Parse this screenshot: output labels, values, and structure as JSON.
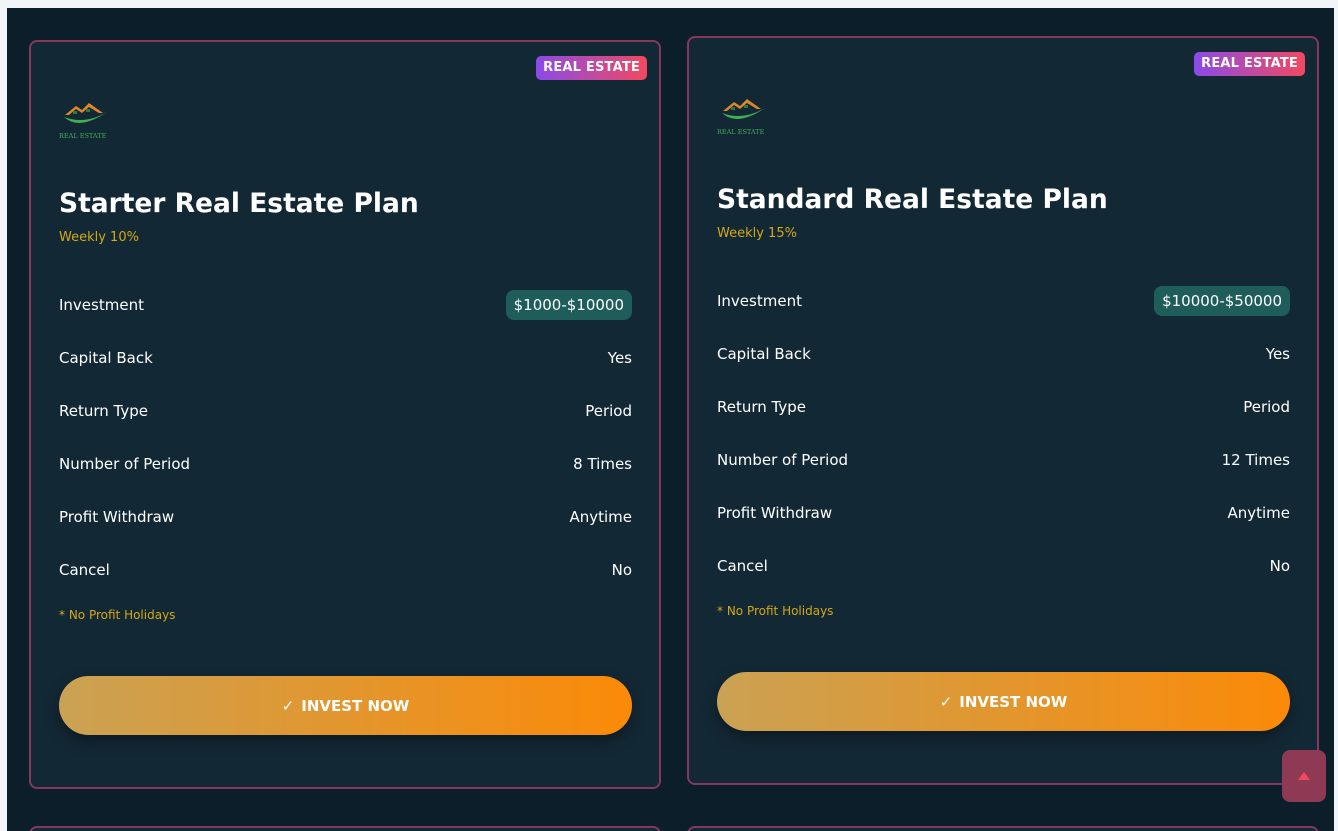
{
  "colors": {
    "page_bg": "#0b1e29",
    "card_bg": "#132835",
    "card_border": "#84385e",
    "accent_gold": "#d4a817",
    "pill_bg": "#1e5d5a",
    "button_gradient": [
      "#caa254",
      "#fb8a07"
    ],
    "badge_gradient": [
      "#8b4ae8",
      "#f2495f"
    ]
  },
  "plans": [
    {
      "badge": "REAL ESTATE",
      "logo_text": "REAL ESTATE",
      "title": "Starter Real Estate Plan",
      "rate": "Weekly 10%",
      "rows": [
        {
          "label": "Investment",
          "value": "$1000-$10000"
        },
        {
          "label": "Capital Back",
          "value": "Yes"
        },
        {
          "label": "Return Type",
          "value": "Period"
        },
        {
          "label": "Number of Period",
          "value": "8 Times"
        },
        {
          "label": "Profit Withdraw",
          "value": "Anytime"
        },
        {
          "label": "Cancel",
          "value": "No"
        }
      ],
      "note": "* No Profit Holidays",
      "button": "INVEST NOW",
      "button_icon": "check-icon"
    },
    {
      "badge": "REAL ESTATE",
      "logo_text": "REAL ESTATE",
      "title": "Standard Real Estate Plan",
      "rate": "Weekly 15%",
      "rows": [
        {
          "label": "Investment",
          "value": "$10000-$50000"
        },
        {
          "label": "Capital Back",
          "value": "Yes"
        },
        {
          "label": "Return Type",
          "value": "Period"
        },
        {
          "label": "Number of Period",
          "value": "12 Times"
        },
        {
          "label": "Profit Withdraw",
          "value": "Anytime"
        },
        {
          "label": "Cancel",
          "value": "No"
        }
      ],
      "note": "* No Profit Holidays",
      "button": "INVEST NOW",
      "button_icon": "check-icon"
    }
  ],
  "scroll_top_icon": "arrow-up-icon"
}
